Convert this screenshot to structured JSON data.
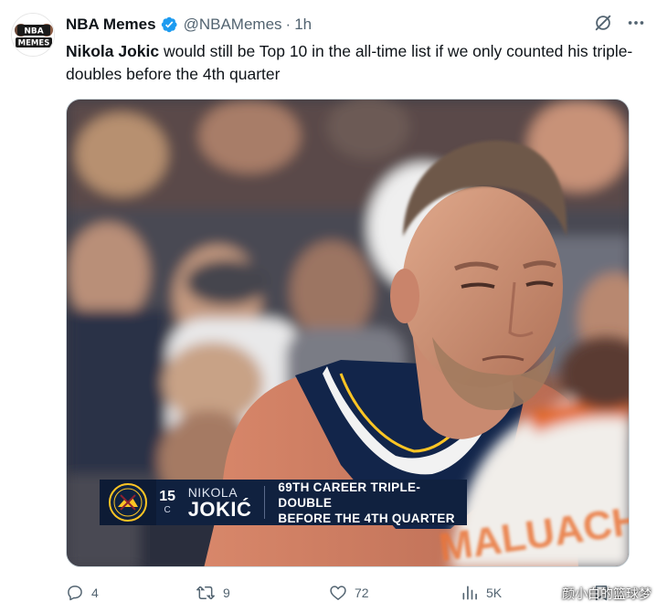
{
  "tweet": {
    "author": {
      "display_name": "NBA Memes",
      "handle": "@NBAMemes",
      "verified": true,
      "avatar_text_top": "NBA",
      "avatar_text_bottom": "MEMES"
    },
    "separator": "·",
    "time": "1h",
    "text": {
      "mention": "Nikola Jokic",
      "body": " would still be Top 10 in the all-time list if we only counted his triple-doubles before the 4th quarter"
    },
    "media": {
      "lower_third": {
        "number": "15",
        "position": "C",
        "first_name": "NIKOLA",
        "last_name": "JOKIĆ",
        "stat_line_1": "69TH CAREER TRIPLE-DOUBLE",
        "stat_line_2": "BEFORE THE 4TH QUARTER"
      },
      "jersey_text": "MALUACH"
    },
    "actions": {
      "replies": "4",
      "retweets": "9",
      "likes": "72",
      "views": "5K"
    }
  },
  "watermark": "颜小白的篮球梦",
  "colors": {
    "verified_blue": "#1d9bf0",
    "secondary_text": "#536471",
    "nuggets_navy": "#0e2240",
    "nuggets_gold": "#fec524"
  },
  "icons": {
    "grok": "grok-icon",
    "more": "more-icon",
    "reply": "reply-icon",
    "retweet": "retweet-icon",
    "like": "like-icon",
    "views": "views-icon",
    "bookmark": "bookmark-icon"
  }
}
